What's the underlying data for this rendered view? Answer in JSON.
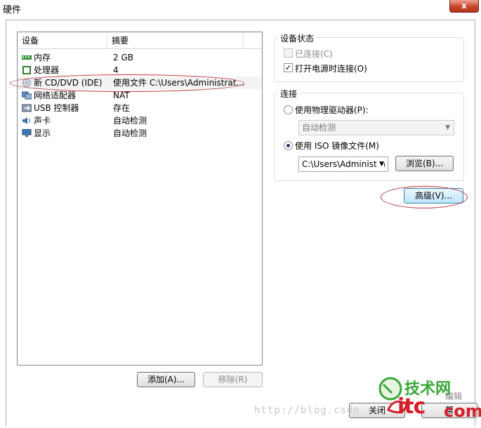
{
  "window": {
    "title": "硬件",
    "close_glyph": "x"
  },
  "device_list": {
    "columns": [
      "设备",
      "摘要"
    ],
    "rows": [
      {
        "name": "内存",
        "summary": "2 GB",
        "icon": "memory-icon"
      },
      {
        "name": "处理器",
        "summary": "4",
        "icon": "processor-icon"
      },
      {
        "name": "新 CD/DVD (IDE)",
        "summary": "使用文件 C:\\Users\\Administrat...",
        "icon": "cd-dvd-icon"
      },
      {
        "name": "网络适配器",
        "summary": "NAT",
        "icon": "network-adapter-icon"
      },
      {
        "name": "USB 控制器",
        "summary": "存在",
        "icon": "usb-icon"
      },
      {
        "name": "声卡",
        "summary": "自动检测",
        "icon": "sound-icon"
      },
      {
        "name": "显示",
        "summary": "自动检测",
        "icon": "display-icon"
      }
    ],
    "selected_index": 2
  },
  "buttons": {
    "add": "添加(A)...",
    "remove": "移除(R)",
    "browse": "浏览(B)...",
    "advanced": "高级(V)...",
    "close": "关闭",
    "help": "帮"
  },
  "device_status": {
    "title": "设备状态",
    "connected": {
      "label": "已连接(C)",
      "checked": false,
      "disabled": true
    },
    "connect_at_power_on": {
      "label": "打开电源时连接(O)",
      "checked": true
    }
  },
  "connection": {
    "title": "连接",
    "physical": {
      "label": "使用物理驱动器(P):",
      "selected": false
    },
    "physical_drive_value": "自动检测",
    "iso": {
      "label": "使用 ISO 镜像文件(M)",
      "selected": true
    },
    "iso_path": "C:\\Users\\Administra"
  },
  "watermark": {
    "url": "http://blog.csdn",
    "logo_text": "技术网",
    "logo_letters": "itc",
    "logo_suffix": "com",
    "logo_small": "编辑"
  },
  "colors": {
    "annotation": "#c0303a",
    "logo_green": "#3aa83a",
    "logo_red": "#d3202a"
  }
}
